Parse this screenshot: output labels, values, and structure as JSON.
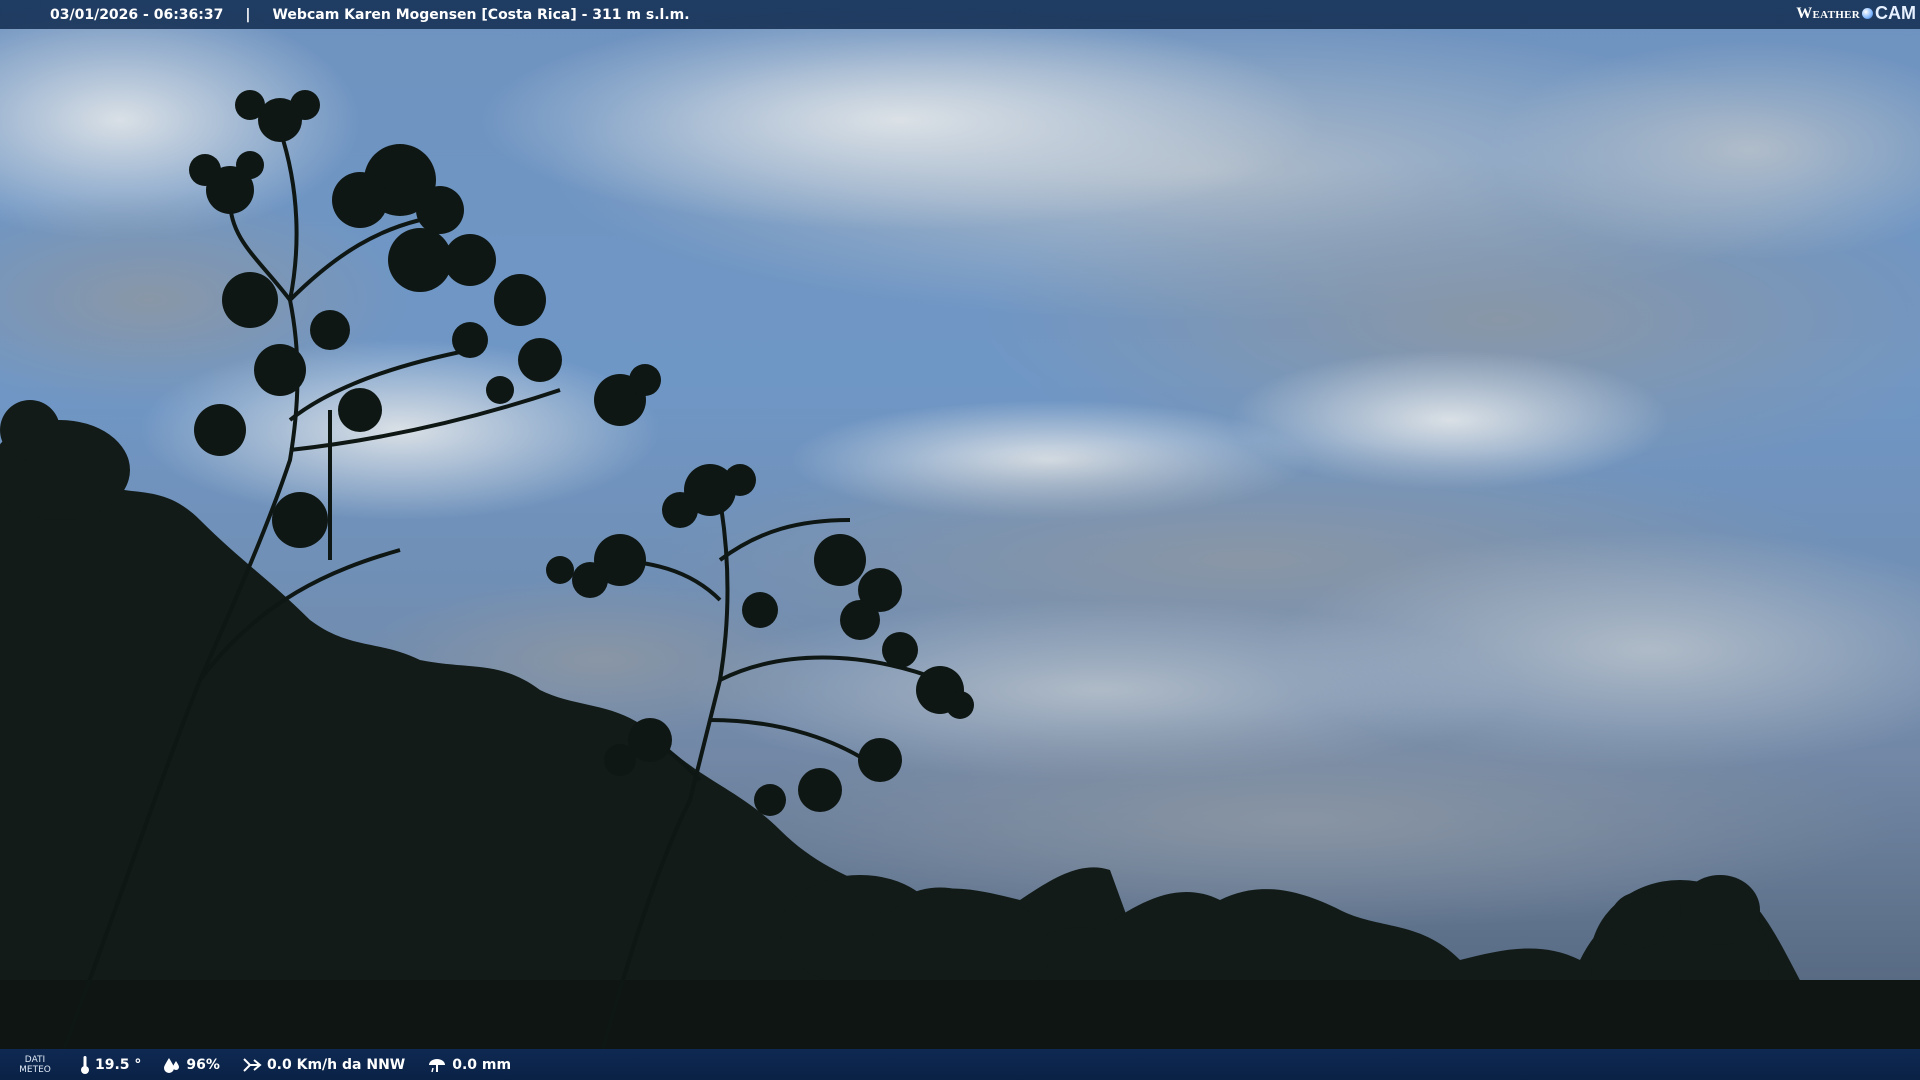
{
  "overlay": {
    "datetime": "03/01/2026 - 06:36:37",
    "separator": "|",
    "camera_title": "Webcam Karen Mogensen [Costa Rica]  - 311 m s.l.m.",
    "brand_weather": "Weather",
    "brand_cam": "CAM"
  },
  "weather": {
    "label_line1": "DATI",
    "label_line2": "METEO",
    "temperature": "19.5 °",
    "humidity": "96%",
    "wind": "0.0 Km/h da NNW",
    "rain": "0.0 mm"
  },
  "icons": {
    "temperature": "thermometer-icon",
    "humidity": "humidity-drop-icon",
    "wind": "wind-icon",
    "rain": "rain-gauge-icon"
  },
  "colors": {
    "bar_bg": "#17325a",
    "sky_top": "#5d86b8",
    "cloud": "#c7cfd6",
    "foliage": "#111a17"
  }
}
